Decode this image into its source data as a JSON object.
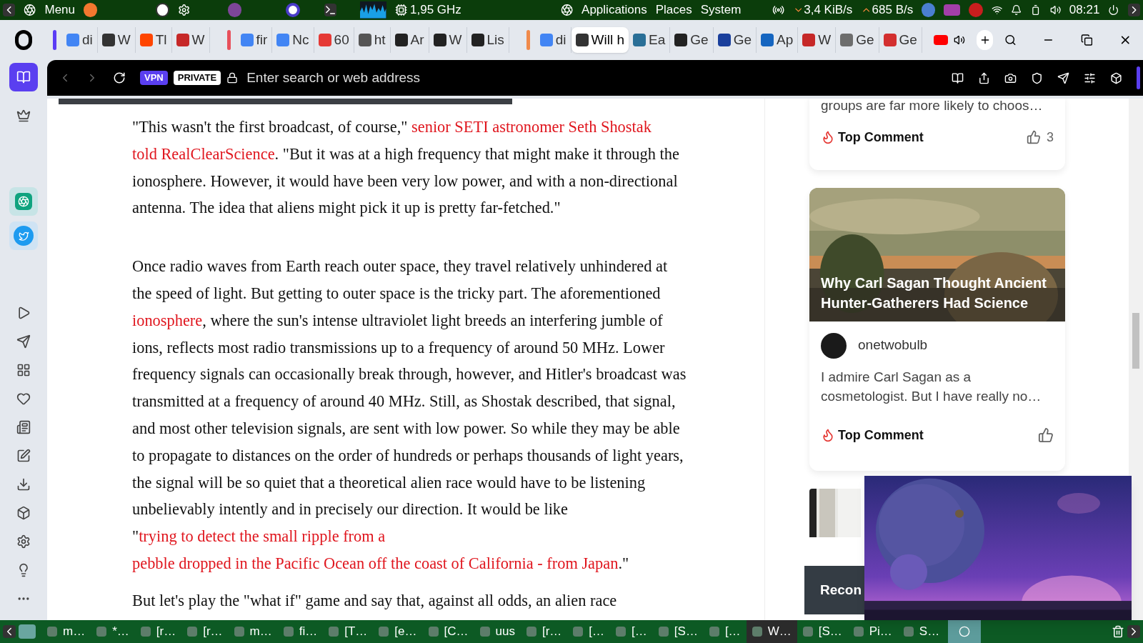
{
  "top_panel": {
    "menu_label": "Menu",
    "cpu_freq": "1,95 GHz",
    "menus": [
      "Applications",
      "Places",
      "System"
    ],
    "net_down": "3,4 KiB/s",
    "net_up": "685 B/s",
    "clock": "08:21"
  },
  "tab_groups": [
    {
      "color": "#5b3cf5",
      "tabs": [
        {
          "label": "di",
          "color": "#4285f4",
          "selected": false
        },
        {
          "label": "W",
          "color": "#333333",
          "selected": false
        },
        {
          "label": "Tl",
          "color": "#ff4500",
          "selected": false
        },
        {
          "label": "W",
          "color": "#c62828",
          "selected": false
        }
      ]
    },
    {
      "color": "#e8505b",
      "tabs": [
        {
          "label": "fir",
          "color": "#4285f4",
          "selected": false
        },
        {
          "label": "Nc",
          "color": "#4285f4",
          "selected": false
        },
        {
          "label": "60",
          "color": "#e53935",
          "selected": false
        },
        {
          "label": "ht",
          "color": "#555555",
          "selected": false
        },
        {
          "label": "Ar",
          "color": "#222222",
          "selected": false
        },
        {
          "label": "W",
          "color": "#222222",
          "selected": false
        },
        {
          "label": "Lis",
          "color": "#222222",
          "selected": false
        }
      ]
    },
    {
      "color": "#f08a4b",
      "tabs": [
        {
          "label": "di",
          "color": "#4285f4",
          "selected": false
        },
        {
          "label": "Will h",
          "color": "#333333",
          "selected": true
        },
        {
          "label": "Ea",
          "color": "#2a6f97",
          "selected": false
        },
        {
          "label": "Ge",
          "color": "#222222",
          "selected": false
        },
        {
          "label": "Ge",
          "color": "#1a3f9c",
          "selected": false
        },
        {
          "label": "Ap",
          "color": "#1565c0",
          "selected": false
        },
        {
          "label": "W",
          "color": "#c62828",
          "selected": false
        },
        {
          "label": "Ge",
          "color": "#6d6d6d",
          "selected": false
        },
        {
          "label": "Ge",
          "color": "#d32f2f",
          "selected": false
        }
      ]
    }
  ],
  "address_bar": {
    "vpn": "VPN",
    "private": "PRIVATE",
    "placeholder": "Enter search or web address"
  },
  "article": {
    "paragraphs": [
      [
        {
          "kind": "text",
          "text": "\"This wasn't the first broadcast, of course,\" "
        },
        {
          "kind": "link",
          "text": "senior SETI astronomer Seth Shostak"
        },
        {
          "kind": "link",
          "text": "told RealClearScience"
        },
        {
          "kind": "text",
          "text": ". \"But it was at a high frequency that might make it through the ionosphere. However, it would have been very low power, and with a non-directional antenna. The idea that aliens might pick it up is pretty far-fetched.\""
        }
      ],
      [
        {
          "kind": "text",
          "text": "Once radio waves from Earth reach outer space, they travel relatively unhindered at the speed of light. But getting to outer space is the tricky part. The aforementioned "
        },
        {
          "kind": "link",
          "text": "ionosphere"
        },
        {
          "kind": "text",
          "text": ", where the sun's intense ultraviolet light breeds an interfering jumble of ions, reflects most radio transmissions up to a frequency of around 50 MHz. Lower frequency signals can occasionally break through, however, and Hitler's broadcast was transmitted at a frequency of around 40 MHz. Still, as Shostak described, that signal, and most other television signals, are sent with low power. So while they may be able to propagate to distances on the order of hundreds or perhaps thousands of light years, the signal will be so quiet that a theoretical alien race would have to be listening unbelievably intently and in precisely our direction. It would be like \""
        },
        {
          "kind": "link",
          "text": "trying to detect the small ripple from a"
        },
        {
          "kind": "link",
          "text": "pebble dropped in the Pacific Ocean off the coast of California - from Japan"
        },
        {
          "kind": "text",
          "text": ".\""
        }
      ],
      [
        {
          "kind": "text",
          "text": "But let's play the \"what if\" game and say that, against all odds, an alien race"
        }
      ]
    ]
  },
  "sidebar_cards": [
    {
      "kind": "comment",
      "excerpt": "groups are far more likely to choos…",
      "badge": "Top Comment",
      "likes": "3"
    },
    {
      "kind": "story",
      "title": "Why Carl Sagan Thought Ancient Hunter-Gatherers Had Science",
      "username": "onetwobulb",
      "comment": "I admire Carl Sagan as a cosmetologist. But I have really no…",
      "badge": "Top Comment"
    }
  ],
  "recommended": {
    "heading": "Recon"
  },
  "taskbar": [
    {
      "label": "m…",
      "selected": false
    },
    {
      "label": "*…",
      "selected": false
    },
    {
      "label": "[r…",
      "selected": false
    },
    {
      "label": "[r…",
      "selected": false
    },
    {
      "label": "m…",
      "selected": false
    },
    {
      "label": "fi…",
      "selected": false
    },
    {
      "label": "[T…",
      "selected": false
    },
    {
      "label": "[e…",
      "selected": false
    },
    {
      "label": "[C…",
      "selected": false
    },
    {
      "label": "uus",
      "selected": false
    },
    {
      "label": "[r…",
      "selected": false
    },
    {
      "label": "[…",
      "selected": false
    },
    {
      "label": "[…",
      "selected": false
    },
    {
      "label": "[S…",
      "selected": false
    },
    {
      "label": "[…",
      "selected": false
    },
    {
      "label": "W…",
      "selected": true
    },
    {
      "label": "[S…",
      "selected": false
    },
    {
      "label": "Pi…",
      "selected": false
    },
    {
      "label": "S…",
      "selected": false
    }
  ]
}
